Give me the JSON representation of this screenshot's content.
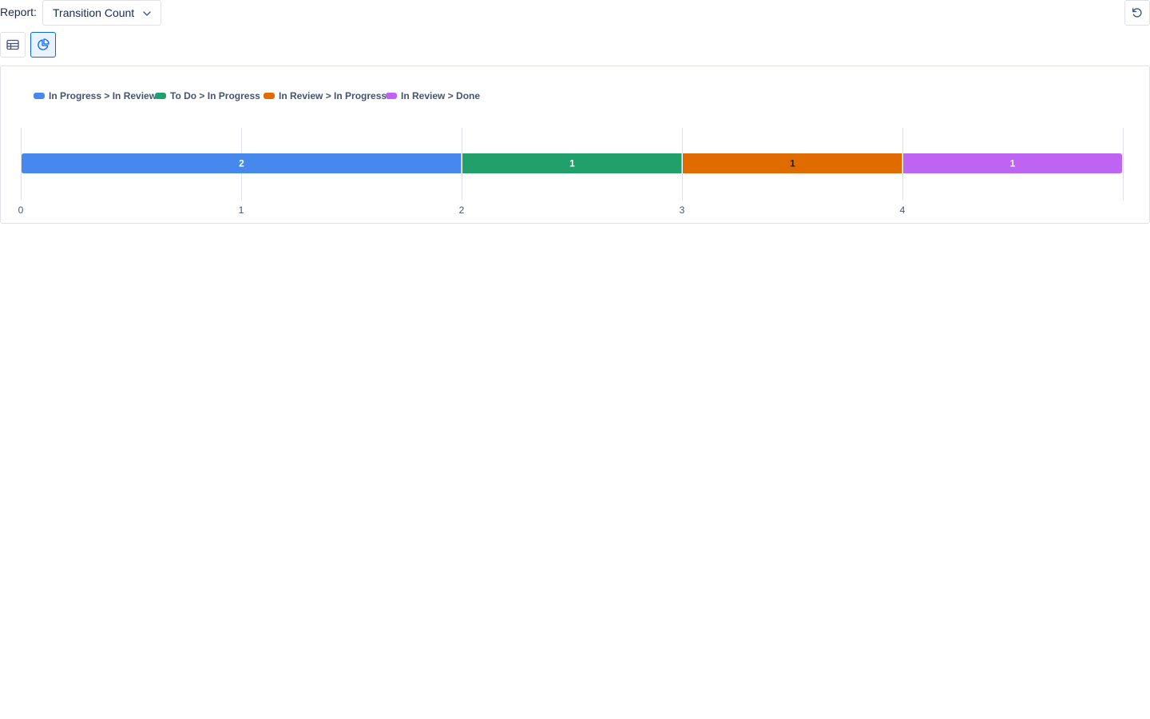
{
  "toolbar": {
    "report_label": "Report:",
    "report_value": "Transition Count",
    "report_select_icon": "chevron-down-icon",
    "refresh_icon": "refresh-icon"
  },
  "view_toggle": {
    "table_icon": "table-icon",
    "chart_icon": "pie-chart-icon",
    "selected": "chart"
  },
  "chart_data": {
    "type": "bar",
    "orientation": "horizontal",
    "stacked": true,
    "categories": [
      ""
    ],
    "series": [
      {
        "name": "In Progress > In Review",
        "values": [
          2
        ],
        "color": "#4688ec"
      },
      {
        "name": "To Do > In Progress",
        "values": [
          1
        ],
        "color": "#22a06b"
      },
      {
        "name": "In Review > In Progress",
        "values": [
          1
        ],
        "color": "#e06c00"
      },
      {
        "name": "In Review > Done",
        "values": [
          1
        ],
        "color": "#bf63f3"
      }
    ],
    "xticks": [
      "0",
      "1",
      "2",
      "3",
      "4"
    ],
    "xlim": [
      0,
      5
    ],
    "grid": true,
    "legend_position": "top-left",
    "title": "",
    "xlabel": "",
    "ylabel": ""
  }
}
